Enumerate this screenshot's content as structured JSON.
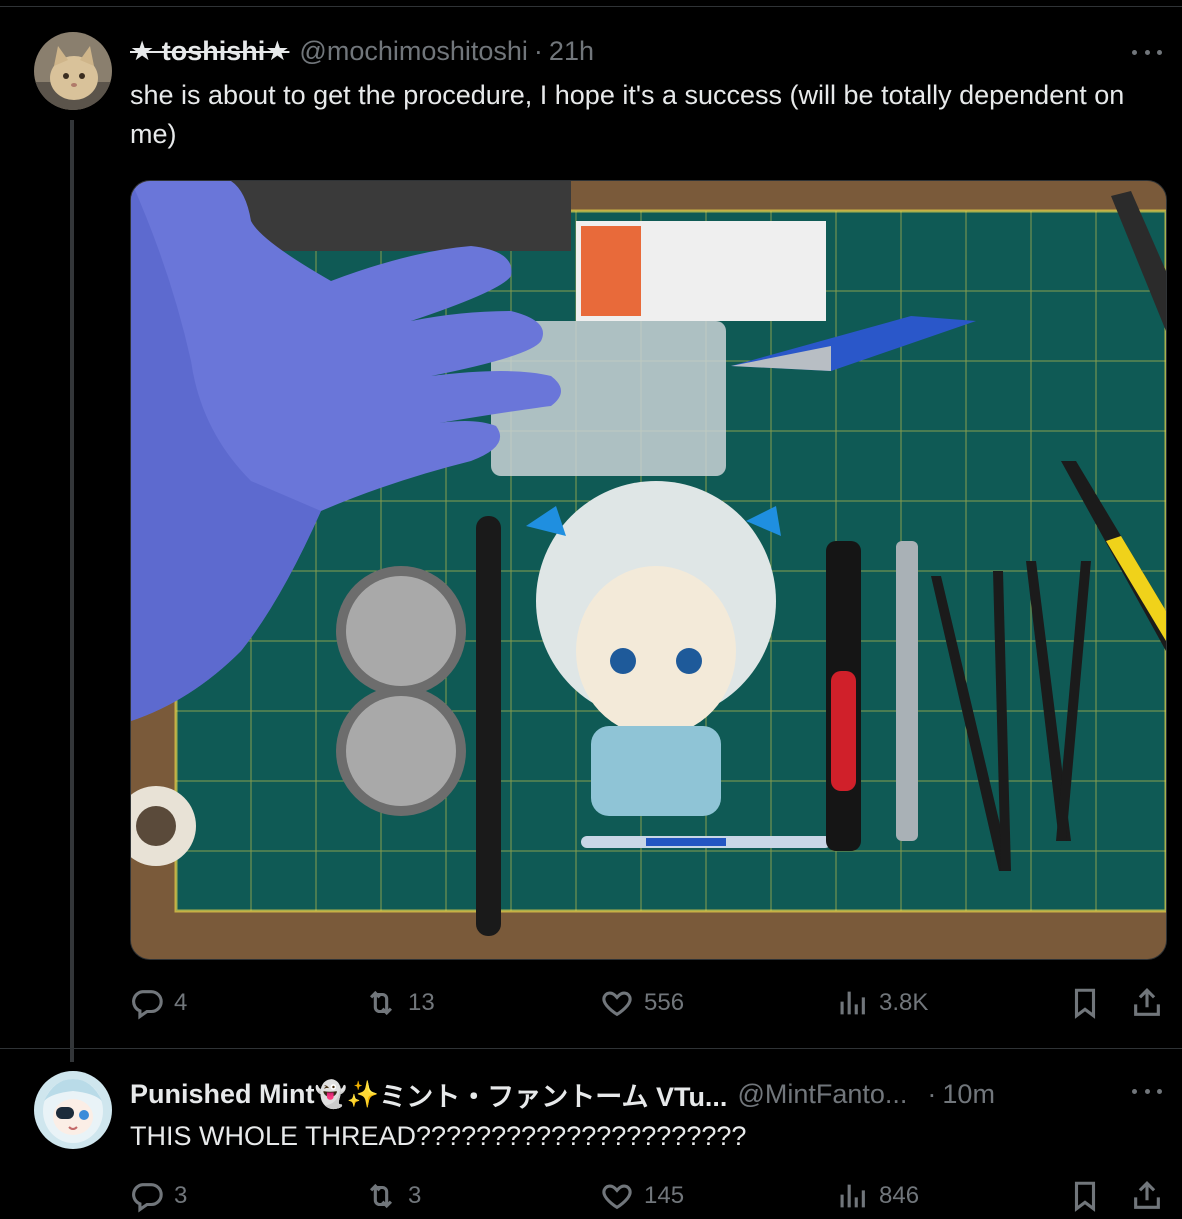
{
  "tweet1": {
    "display_name": "★ toshishi★",
    "handle": "@mochimoshitoshi",
    "separator": "·",
    "time": "21h",
    "text": "she is about to get the procedure, I hope it's a success (will be totally dependent on me)",
    "stats": {
      "replies": "4",
      "reposts": "13",
      "likes": "556",
      "views": "3.8K"
    }
  },
  "tweet2": {
    "display_name": "Punished Mint",
    "name_emojis": "👻✨",
    "name_suffix": "ミント・ファントーム VTu...",
    "handle": "@MintFanto...",
    "separator": "·",
    "time": "10m",
    "text": "THIS WHOLE THREAD??????????????????????",
    "stats": {
      "replies": "3",
      "reposts": "3",
      "likes": "145",
      "views": "846"
    }
  },
  "icons": {
    "reply": "reply-icon",
    "repost": "repost-icon",
    "like": "heart-icon",
    "views": "views-icon",
    "bookmark": "bookmark-icon",
    "share": "share-icon",
    "more": "more-icon"
  },
  "colors": {
    "background": "#000000",
    "text": "#e7e9ea",
    "muted": "#71767b",
    "border": "#2f3336"
  }
}
